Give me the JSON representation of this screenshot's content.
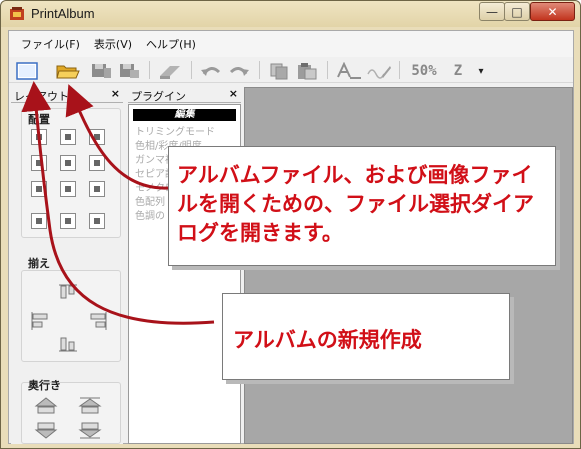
{
  "window": {
    "title": "PrintAlbum",
    "minimize_glyph": "—",
    "maximize_glyph": "□",
    "close_glyph": "✕"
  },
  "menu": [
    "ファイル(F)",
    "表示(V)",
    "ヘルプ(H)"
  ],
  "toolbar": {
    "zoom_label": "50%",
    "z_label": "Z",
    "dropdown_glyph": "▾",
    "icons": [
      "new-album-icon",
      "open-folder-icon",
      "save-icon",
      "save-as-icon",
      "erase-icon",
      "undo-icon",
      "redo-icon",
      "copy-icon",
      "paste-icon",
      "text-icon",
      "pen-icon"
    ]
  },
  "layout_panel": {
    "title": "レイアウト",
    "close": "×",
    "groups": [
      {
        "label": "配置"
      },
      {
        "label": "揃え"
      },
      {
        "label": "奥行き"
      }
    ]
  },
  "plugin_panel": {
    "title": "プラグイン",
    "close": "×",
    "header": "編集",
    "items": [
      "トリミングモード",
      "色相/彩度/明度",
      "ガンマ補",
      "セピア調",
      "モノクロ",
      "色配列",
      "色調の"
    ]
  },
  "callouts": {
    "open_file": "アルバムファイル、および画像ファイルを開くための、ファイル選択ダイアログを開きます。",
    "new_album": "アルバムの新規作成"
  },
  "colors": {
    "callout_text": "#d10f17",
    "arrow": "#a8121a",
    "canvas": "#a7a7a7"
  }
}
